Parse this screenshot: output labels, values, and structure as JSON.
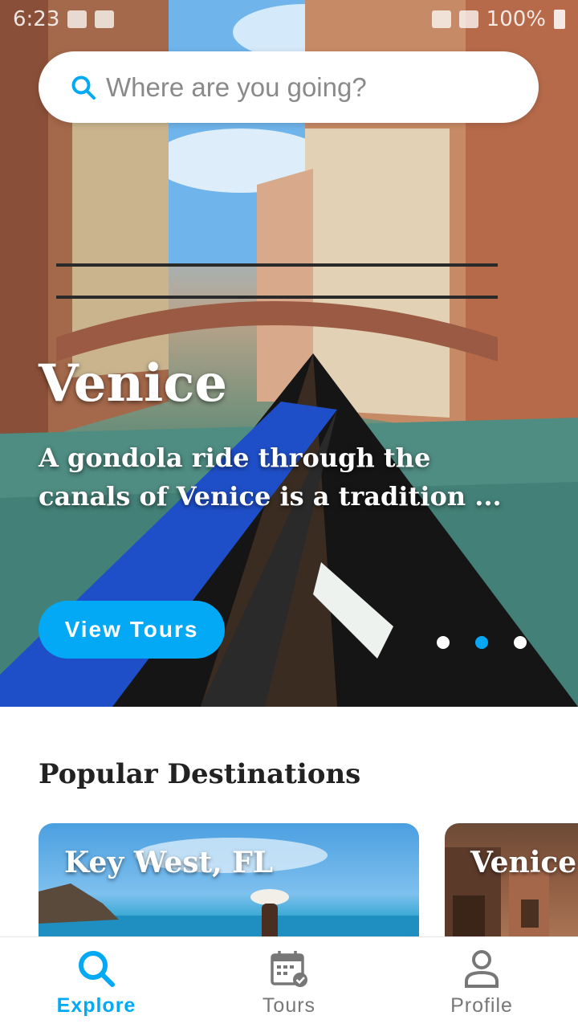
{
  "status_bar": {
    "time": "6:23",
    "battery": "100%"
  },
  "search": {
    "placeholder": "Where are you going?",
    "value": ""
  },
  "hero": {
    "title": "Venice",
    "description": "A gondola ride through the canals of Venice is a tradition ...",
    "button_label": "View Tours",
    "carousel": {
      "count": 3,
      "active_index": 1
    }
  },
  "popular": {
    "title": "Popular Destinations",
    "cards": [
      {
        "label": "Key West, FL"
      },
      {
        "label": "Venice"
      }
    ]
  },
  "nav": {
    "items": [
      {
        "label": "Explore",
        "icon": "search-icon",
        "active": true
      },
      {
        "label": "Tours",
        "icon": "calendar-check-icon",
        "active": false
      },
      {
        "label": "Profile",
        "icon": "person-icon",
        "active": false
      }
    ]
  },
  "colors": {
    "accent": "#03a9f4",
    "inactive": "#777777"
  }
}
